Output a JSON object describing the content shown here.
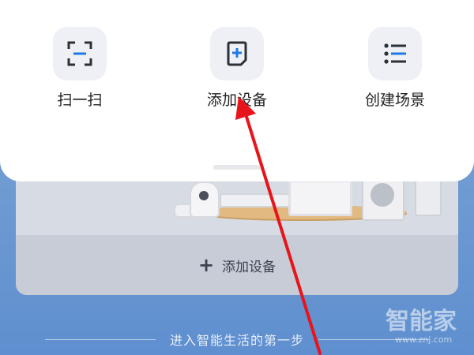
{
  "popup": {
    "actions": [
      {
        "label": "扫一扫",
        "icon": "scan-icon"
      },
      {
        "label": "添加设备",
        "icon": "add-device-icon"
      },
      {
        "label": "创建场景",
        "icon": "scene-list-icon"
      }
    ]
  },
  "card": {
    "add_device_label": "添加设备",
    "add_icon": "plus-icon"
  },
  "footer": {
    "text": "进入智能生活的第一步"
  },
  "watermark": {
    "main": "智能家",
    "sub": "www.znj.com"
  },
  "colors": {
    "accent": "#1f7ae0",
    "icon_dark": "#2b2f38",
    "arrow": "#e8141c",
    "sheet_bg": "#ffffff",
    "icon_tile_bg": "#eef0f6"
  }
}
